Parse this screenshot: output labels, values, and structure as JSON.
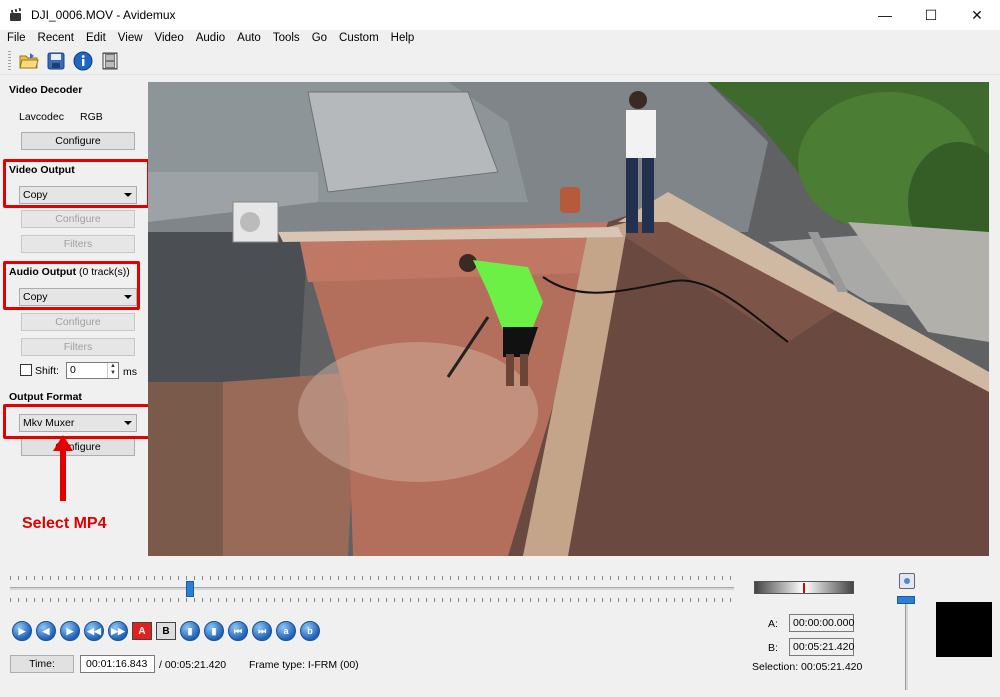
{
  "window": {
    "title": "DJI_0006.MOV - Avidemux",
    "controls": {
      "minimize": "—",
      "maximize": "☐",
      "close": "✕"
    }
  },
  "menu": [
    "File",
    "Recent",
    "Edit",
    "View",
    "Video",
    "Audio",
    "Auto",
    "Tools",
    "Go",
    "Custom",
    "Help"
  ],
  "toolbar": [
    "open-file-icon",
    "save-icon",
    "info-icon",
    "filmstrip-icon"
  ],
  "video_decoder": {
    "title": "Video Decoder",
    "codec": "Lavcodec",
    "colorspace": "RGB",
    "configure": "Configure"
  },
  "video_output": {
    "title": "Video Output",
    "selected": "Copy",
    "configure": "Configure",
    "filters": "Filters"
  },
  "audio_output": {
    "title": "Audio Output",
    "tracks": "(0 track(s))",
    "selected": "Copy",
    "configure": "Configure",
    "filters": "Filters",
    "shift_label": "Shift:",
    "shift_value": "0",
    "shift_unit": "ms"
  },
  "output_format": {
    "title": "Output Format",
    "selected": "Mkv Muxer",
    "configure": "Configure"
  },
  "annotation": {
    "text": "Select MP4",
    "color": "#e00000"
  },
  "playback": {
    "position_fraction": 0.25,
    "buttons": [
      "play-icon",
      "rewind-icon",
      "forward-icon",
      "prev-keyframe-icon",
      "next-keyframe-icon",
      "set-marker-a-icon",
      "set-marker-b-icon",
      "prev-black-icon",
      "next-black-icon",
      "goto-start-icon",
      "goto-end-icon",
      "goto-marker-a-icon",
      "goto-marker-b-icon"
    ],
    "marker_a_label": "A",
    "marker_b_label": "B"
  },
  "time": {
    "button": "Time:",
    "current": "00:01:16.843",
    "total": "/ 00:05:21.420",
    "frame_type": "Frame type:  I-FRM (00)"
  },
  "selection": {
    "a_label": "A:",
    "a_value": "00:00:00.000",
    "b_label": "B:",
    "b_value": "00:05:21.420",
    "summary": "Selection: 00:05:21.420"
  },
  "volume_level": 0.95
}
